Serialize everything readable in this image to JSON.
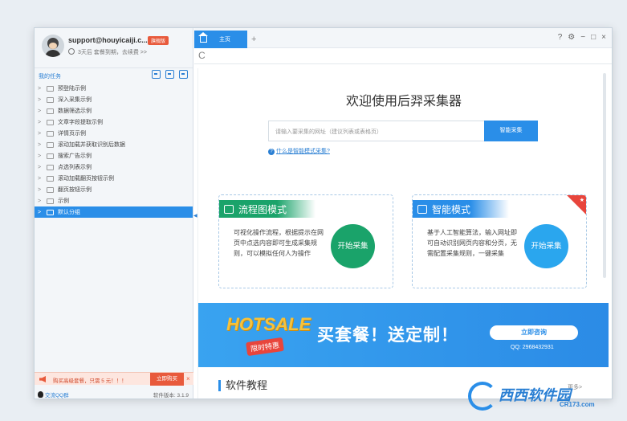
{
  "profile": {
    "email": "support@houyicaiji.c...",
    "badge": "旗舰版",
    "renew_text": "3天后 套餐到期，去续费 >>"
  },
  "tasks": {
    "title": "我的任务",
    "items": [
      {
        "label": "预登陆示例"
      },
      {
        "label": "深入采集示例"
      },
      {
        "label": "数据筛选示例"
      },
      {
        "label": "文章字段提取示例"
      },
      {
        "label": "详情页示例"
      },
      {
        "label": "滚动加载并获取识别后数据"
      },
      {
        "label": "搜索广告示例"
      },
      {
        "label": "点选列表示例"
      },
      {
        "label": "滚动加载翻页按钮示例"
      },
      {
        "label": "翻页按钮示例"
      },
      {
        "label": "示例"
      },
      {
        "label": "默认分组"
      }
    ],
    "selected_index": 11
  },
  "promo": {
    "text": "购买高级套餐，只需 5 元！！！",
    "buy_label": "立即购买",
    "close": "×"
  },
  "footer": {
    "qq_label": "交流QQ群",
    "version": "软件版本: 3.1.9"
  },
  "tabbar": {
    "tab_label": "主页",
    "add": "+",
    "controls": [
      "?",
      "⚙",
      "−",
      "□",
      "×"
    ]
  },
  "urlbar": {
    "refresh": "C"
  },
  "main": {
    "welcome": "欢迎使用后羿采集器",
    "search_placeholder": "请输入要采集的网址（建议列表或表格页）",
    "smart_button": "智能采集",
    "help_link": "什么是智能模式采集?",
    "flow_mode": {
      "title": "流程图模式",
      "desc": "可视化操作流程，根据提示在网页中点选内容即可生成采集规则，可以模拟任何人为操作",
      "button": "开始采集"
    },
    "smart_mode": {
      "title": "智能模式",
      "desc": "基于人工智能算法，输入网址即可自动识别网页内容和分页，无需配置采集规则，一键采集",
      "button": "开始采集"
    },
    "banner": {
      "hotsale": "HOTSALE",
      "limited": "限时特惠",
      "slogan": "买套餐！送定制！",
      "consult": "立即咨询",
      "qq": "QQ: 2968432931"
    },
    "tutorial": "软件教程",
    "more": "更多>"
  },
  "watermark": {
    "name": "西西软件园",
    "url": "CR173.com"
  },
  "colors": {
    "accent_blue": "#2a8ee8",
    "flow_green": "#1aa36a",
    "promo_red": "#e85a3c"
  }
}
